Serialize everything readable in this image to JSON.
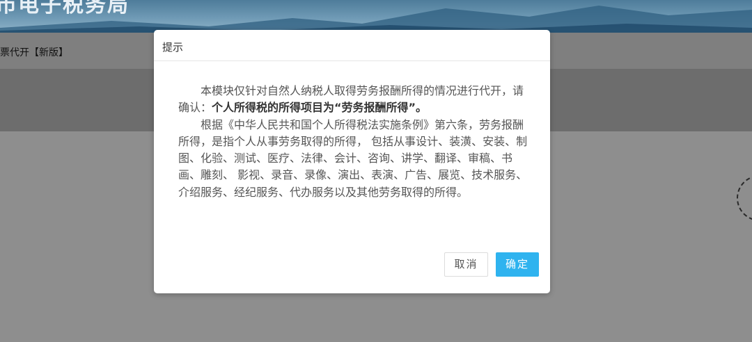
{
  "page": {
    "banner_title": "市电子税务局",
    "nav_text": "票代开【新版】"
  },
  "dialog": {
    "title": "提示",
    "para1_prefix": "本模块仅针对自然人纳税人取得劳务报酬所得的情况进行代开，请确认：",
    "para1_emphasis": "个人所得税的所得项目为“劳务报酬所得”。",
    "para2": "根据《中华人民共和国个人所得税法实施条例》第六条，劳务报酬所得，是指个人从事劳务取得的所得， 包括从事设计、装潢、安装、制图、化验、测试、医疗、法律、会计、咨询、讲学、翻译、审稿、书画、雕刻、 影视、录音、录像、演出、表演、广告、展览、技术服务、介绍服务、经纪服务、代办服务以及其他劳务取得的所得。",
    "cancel_label": "取消",
    "confirm_label": "确定"
  },
  "colors": {
    "confirm_button": "#2fb3ef",
    "overlay": "#8e8e8e"
  }
}
